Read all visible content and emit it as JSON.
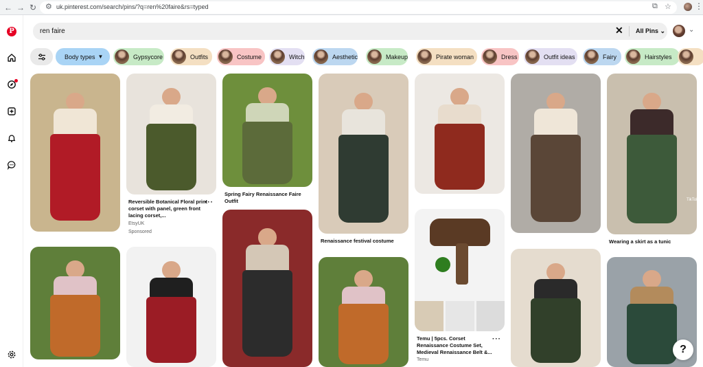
{
  "browser": {
    "url": "uk.pinterest.com/search/pins/?q=ren%20faire&rs=typed",
    "back_icon": "arrow-left",
    "forward_icon": "arrow-right",
    "reload_icon": "reload"
  },
  "search": {
    "query": "ren faire",
    "clear_icon": "close-x",
    "scope_label": "All Pins"
  },
  "filters": {
    "body_types_label": "Body types",
    "chips": [
      {
        "label": "Gypsycore",
        "color": "#c7eac6"
      },
      {
        "label": "Outfits",
        "color": "#f4dfc2"
      },
      {
        "label": "Costume",
        "color": "#f8c4c4"
      },
      {
        "label": "Witch",
        "color": "#e3dff2"
      },
      {
        "label": "Aesthetic",
        "color": "#bcd7f0"
      },
      {
        "label": "Makeup",
        "color": "#c7eac6"
      },
      {
        "label": "Pirate woman",
        "color": "#f4dfc2"
      },
      {
        "label": "Dress",
        "color": "#f8c4c4"
      },
      {
        "label": "Outfit ideas",
        "color": "#e3dff2"
      },
      {
        "label": "Fairy",
        "color": "#bcd7f0"
      },
      {
        "label": "Hairstyles",
        "color": "#c7eac6"
      },
      {
        "label": "",
        "color": "#f4dfc2"
      }
    ]
  },
  "pins": [
    {
      "title": "",
      "colors": [
        "#c9b58e",
        "#b11b26",
        "#f0e6d6"
      ]
    },
    {
      "title": "Reversible Botanical Floral print corset with panel, green front lacing corset,...",
      "source": "EtsyUK",
      "sponsored": "Sponsored",
      "colors": [
        "#e8e3dc",
        "#4b5a2c",
        "#f2ece2"
      ]
    },
    {
      "title": "Spring Fairy Renaissance Faire Outfit",
      "colors": [
        "#6e8f3c",
        "#5c6b3a",
        "#cfd6b8"
      ]
    },
    {
      "title": "Renaissance festival costume",
      "colors": [
        "#d9cbb9",
        "#2f3b32",
        "#e8e4dc"
      ]
    },
    {
      "title": "",
      "colors": [
        "#ece8e3",
        "#8f2a1e",
        "#e8dccd"
      ]
    },
    {
      "title": "",
      "colors": [
        "#b0aca6",
        "#5a4637",
        "#efe6d8"
      ]
    },
    {
      "title": "Wearing a skirt as a tunic",
      "colors": [
        "#c9bfae",
        "#3d5a3a",
        "#3c2a2a"
      ]
    },
    {
      "title": "",
      "colors": [
        "#5f7f3a",
        "#c06a2a",
        "#e0c2c7"
      ]
    },
    {
      "title": "",
      "colors": [
        "#f2f2f2",
        "#9b1c25",
        "#1f1f1f"
      ]
    },
    {
      "title": "",
      "colors": [
        "#8a2a2a",
        "#2c2c2c",
        "#d4c7b6"
      ]
    },
    {
      "title": "",
      "colors": [
        "#5f7f3a",
        "#c06a2a",
        "#e0c2c7"
      ]
    },
    {
      "title": "Temu | 5pcs. Corset Renaissance Costume Set, Medieval Renaissance Belt &...",
      "source": "Temu",
      "colors": [
        "#f3f3f3",
        "#5a3a24",
        "#2e7d1f"
      ]
    },
    {
      "title": "",
      "colors": [
        "#e5dccf",
        "#31402a",
        "#2a2a2a"
      ]
    },
    {
      "title": "",
      "colors": [
        "#9aa2a8",
        "#2b4a3a",
        "#b38b5c"
      ]
    }
  ],
  "help_label": "?",
  "tiktok_label": "TikTok"
}
